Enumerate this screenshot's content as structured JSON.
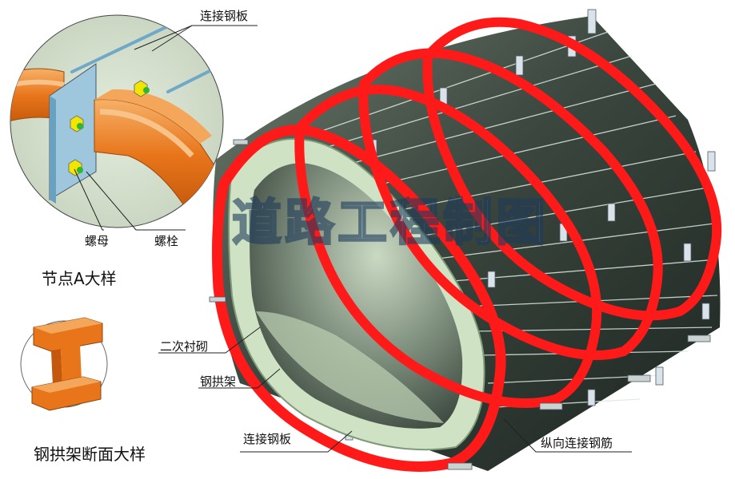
{
  "labels": {
    "top_plate": "连接钢板",
    "nut": "螺母",
    "bolt": "螺栓",
    "detail_title": "节点A大样",
    "secondary_lining": "二次衬砌",
    "steel_arch": "钢拱架",
    "bottom_plate": "连接钢板",
    "longitudinal_rebar": "纵向连接钢筋",
    "section_title": "钢拱架断面大样"
  },
  "watermark": {
    "text": "道路工程制图"
  },
  "colors": {
    "arch_red": "#ff1a1a",
    "steel_orange": "#e8751a",
    "steel_light": "#f4a65a",
    "lining_green": "#cfe3c4",
    "plate_blue": "#8fc4e0",
    "tunnel_dark": "#2e3a33",
    "bolt_yellow": "#f2e600"
  }
}
